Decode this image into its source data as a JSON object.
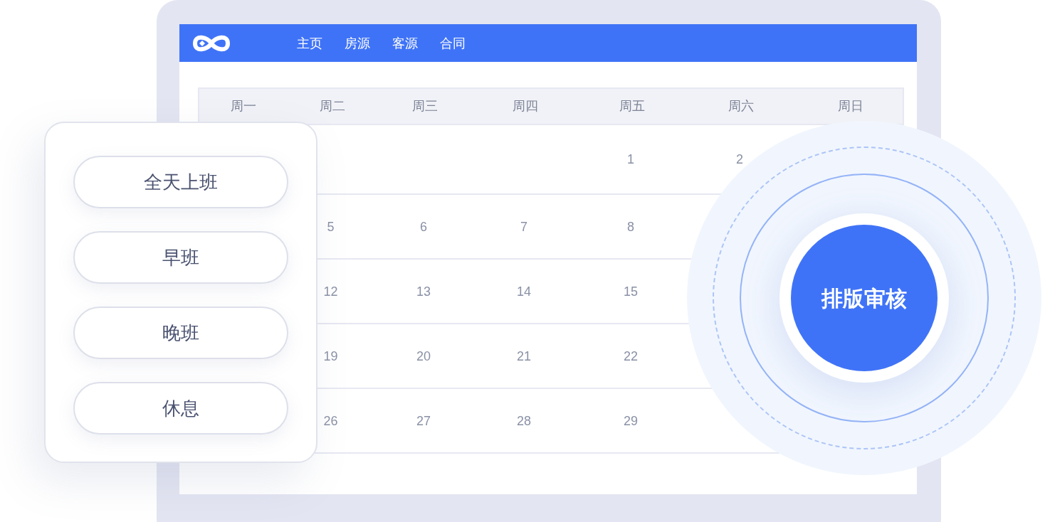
{
  "nav": {
    "items": [
      "主页",
      "房源",
      "客源",
      "合同"
    ]
  },
  "calendar": {
    "weekdays": [
      "周一",
      "周二",
      "周三",
      "周四",
      "周五",
      "周六",
      "周日"
    ],
    "weeks": [
      [
        {
          "kind": "blank"
        },
        {
          "kind": "blank"
        },
        {
          "kind": "blank"
        },
        {
          "kind": "blank"
        },
        {
          "kind": "date",
          "day": "1"
        },
        {
          "kind": "date",
          "day": "2"
        },
        {
          "kind": "blank"
        }
      ],
      [
        {
          "kind": "blank"
        },
        {
          "kind": "date",
          "day": "5"
        },
        {
          "kind": "date",
          "day": "6"
        },
        {
          "kind": "date",
          "day": "7"
        },
        {
          "kind": "date",
          "day": "8"
        },
        {
          "kind": "blank"
        },
        {
          "kind": "blank"
        }
      ],
      [
        {
          "kind": "blank"
        },
        {
          "kind": "date",
          "day": "12"
        },
        {
          "kind": "date",
          "day": "13"
        },
        {
          "kind": "date",
          "day": "14"
        },
        {
          "kind": "date",
          "day": "15"
        },
        {
          "kind": "blank"
        },
        {
          "kind": "blank"
        }
      ],
      [
        {
          "kind": "blank"
        },
        {
          "kind": "date",
          "day": "19"
        },
        {
          "kind": "date",
          "day": "20"
        },
        {
          "kind": "date",
          "day": "21"
        },
        {
          "kind": "date",
          "day": "22"
        },
        {
          "kind": "blank"
        },
        {
          "kind": "blank"
        }
      ],
      [
        {
          "kind": "blank"
        },
        {
          "kind": "date",
          "day": "26"
        },
        {
          "kind": "date",
          "day": "27"
        },
        {
          "kind": "date",
          "day": "28"
        },
        {
          "kind": "date",
          "day": "29"
        },
        {
          "kind": "blank"
        },
        {
          "kind": "blank"
        }
      ]
    ]
  },
  "shift_panel": {
    "options": [
      "全天上班",
      "早班",
      "晚班",
      "休息"
    ]
  },
  "review_button": {
    "label": "排版审核"
  }
}
